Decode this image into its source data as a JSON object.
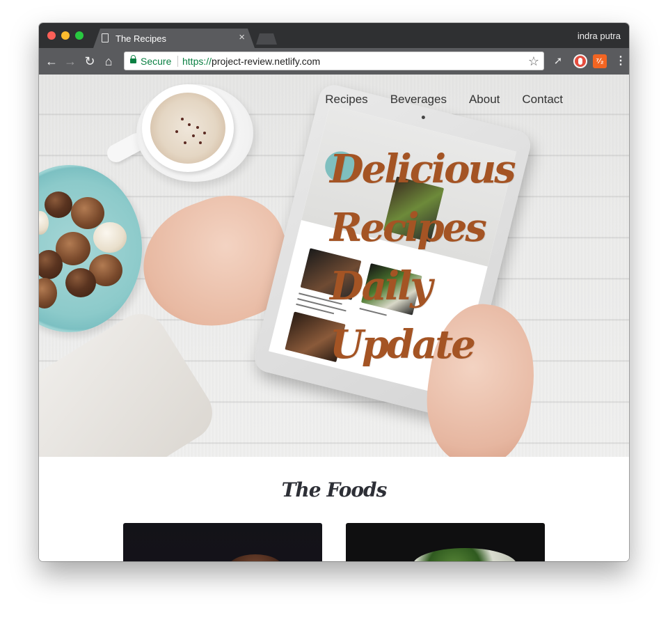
{
  "browser": {
    "tab_title": "The Recipes",
    "tab_close": "×",
    "profile_name": "indra putra",
    "secure_label": "Secure",
    "url_scheme": "https://",
    "url_host": "project-review.netlify.com",
    "ext_badge": "⁷⁄₂"
  },
  "site": {
    "nav": [
      "Recipes",
      "Beverages",
      "About",
      "Contact"
    ],
    "headline": [
      "Delicious",
      "Recipes",
      "Daily",
      "Update"
    ],
    "section_title": "The Foods"
  },
  "colors": {
    "accent": "#a45424",
    "title_dark": "#2d2f36",
    "secure_green": "#0b8043"
  },
  "icons": [
    "back-arrow-icon",
    "forward-arrow-icon",
    "reload-icon",
    "home-icon",
    "lock-icon",
    "star-icon",
    "rocket-icon",
    "shield-icon",
    "menu-dots-icon",
    "page-icon"
  ]
}
